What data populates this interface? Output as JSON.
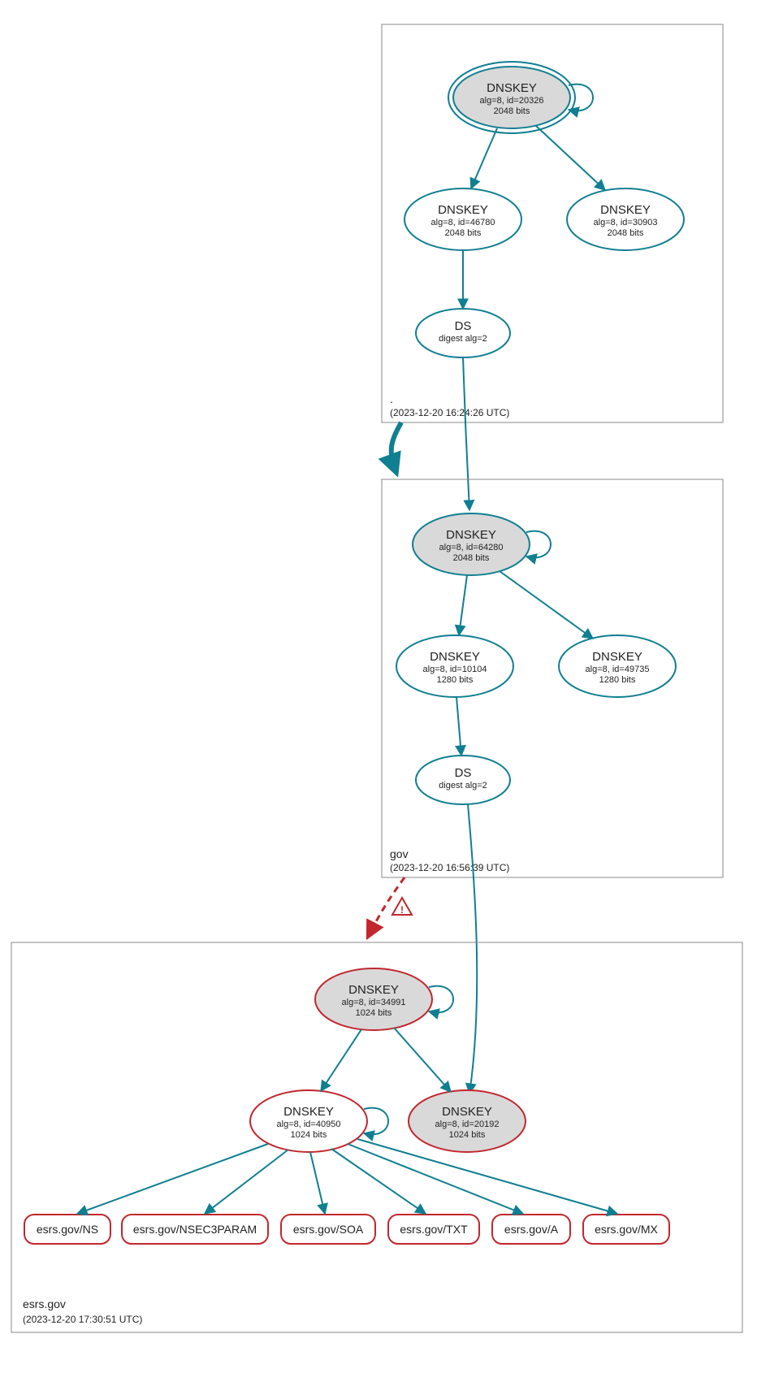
{
  "zones": {
    "root": {
      "name": ".",
      "timestamp": "(2023-12-20 16:24:26 UTC)",
      "nodes": {
        "ksk": {
          "title": "DNSKEY",
          "line2": "alg=8, id=20326",
          "line3": "2048 bits"
        },
        "zsk1": {
          "title": "DNSKEY",
          "line2": "alg=8, id=46780",
          "line3": "2048 bits"
        },
        "zsk2": {
          "title": "DNSKEY",
          "line2": "alg=8, id=30903",
          "line3": "2048 bits"
        },
        "ds": {
          "title": "DS",
          "line2": "digest alg=2"
        }
      }
    },
    "gov": {
      "name": "gov",
      "timestamp": "(2023-12-20 16:56:39 UTC)",
      "nodes": {
        "ksk": {
          "title": "DNSKEY",
          "line2": "alg=8, id=64280",
          "line3": "2048 bits"
        },
        "zsk1": {
          "title": "DNSKEY",
          "line2": "alg=8, id=10104",
          "line3": "1280 bits"
        },
        "zsk2": {
          "title": "DNSKEY",
          "line2": "alg=8, id=49735",
          "line3": "1280 bits"
        },
        "ds": {
          "title": "DS",
          "line2": "digest alg=2"
        }
      }
    },
    "esrs": {
      "name": "esrs.gov",
      "timestamp": "(2023-12-20 17:30:51 UTC)",
      "nodes": {
        "ksk": {
          "title": "DNSKEY",
          "line2": "alg=8, id=34991",
          "line3": "1024 bits"
        },
        "zsk": {
          "title": "DNSKEY",
          "line2": "alg=8, id=40950",
          "line3": "1024 bits"
        },
        "ksk2": {
          "title": "DNSKEY",
          "line2": "alg=8, id=20192",
          "line3": "1024 bits"
        }
      },
      "rrsets": [
        "esrs.gov/NS",
        "esrs.gov/NSEC3PARAM",
        "esrs.gov/SOA",
        "esrs.gov/TXT",
        "esrs.gov/A",
        "esrs.gov/MX"
      ]
    }
  },
  "warning_label": "!"
}
